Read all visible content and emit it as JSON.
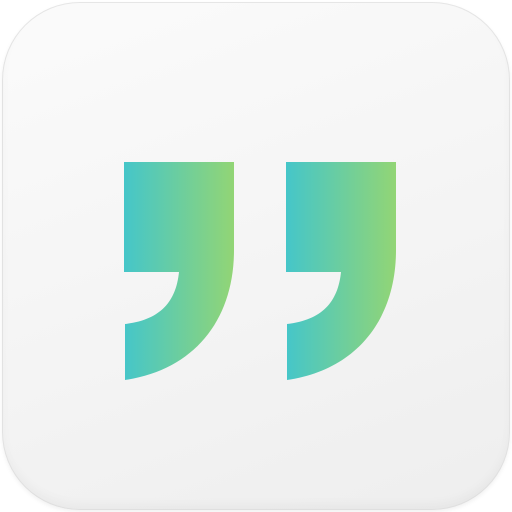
{
  "app_icon": {
    "glyph": "closing-quotation-mark-icon",
    "colors": {
      "tile_background": "#f4f4f4",
      "gradient_start": "#45c6c9",
      "gradient_end": "#92d575"
    }
  }
}
